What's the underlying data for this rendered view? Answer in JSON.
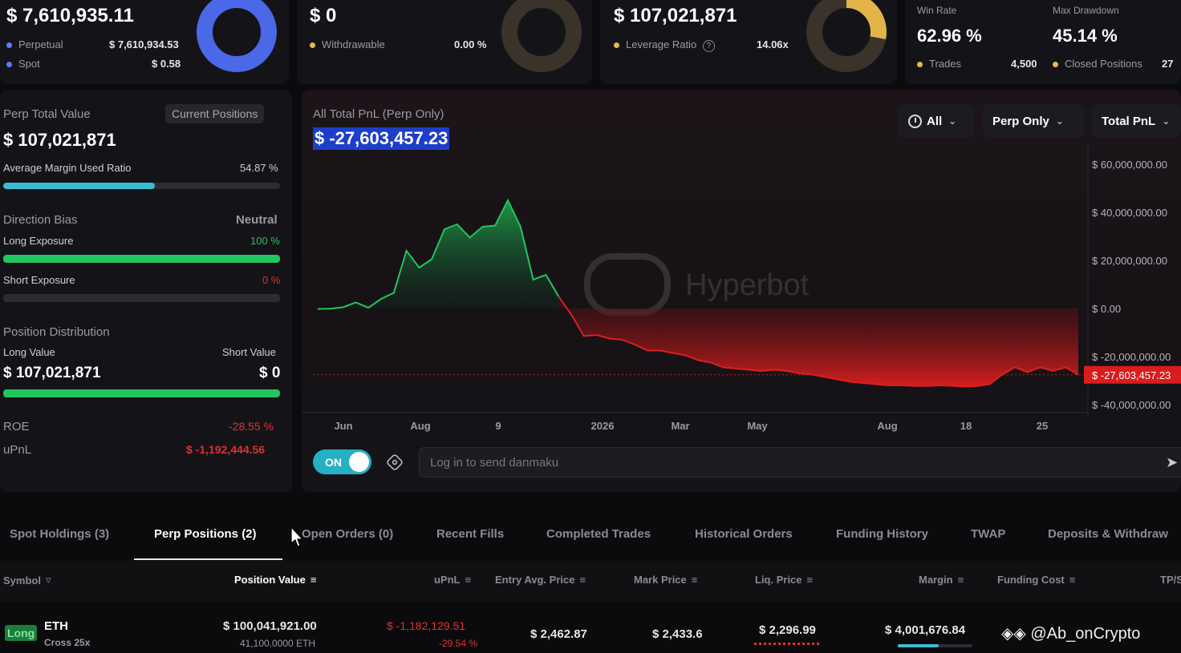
{
  "summary": {
    "total_value": "$ 7,610,935.11",
    "perpetual_label": "Perpetual",
    "perpetual_value": "$ 7,610,934.53",
    "spot_label": "Spot",
    "spot_value": "$ 0.58",
    "withdrawable_total": "$ 0",
    "withdrawable_label": "Withdrawable",
    "withdrawable_pct": "0.00 %",
    "leverage_total": "$ 107,021,871",
    "leverage_label": "Leverage Ratio",
    "leverage_value": "14.06x",
    "win_rate_label": "Win Rate",
    "win_rate_value": "62.96 %",
    "max_drawdown_label": "Max Drawdown",
    "max_drawdown_value": "45.14 %",
    "trades_label": "Trades",
    "trades_value": "4,500",
    "closed_positions_label": "Closed Positions",
    "closed_positions_value": "27"
  },
  "left_panel": {
    "perp_total_label": "Perp Total Value",
    "current_positions_button": "Current Positions",
    "perp_total_value": "$ 107,021,871",
    "avg_margin_label": "Average Margin Used Ratio",
    "avg_margin_value": "54.87 %",
    "avg_margin_fraction": 0.5487,
    "direction_bias_label": "Direction Bias",
    "direction_bias_value": "Neutral",
    "long_exposure_label": "Long Exposure",
    "long_exposure_value": "100 %",
    "long_exposure_fraction": 1.0,
    "short_exposure_label": "Short Exposure",
    "short_exposure_value": "0 %",
    "short_exposure_fraction": 0.0,
    "position_distribution_label": "Position Distribution",
    "long_value_label": "Long Value",
    "short_value_label": "Short Value",
    "long_value": "$ 107,021,871",
    "short_value": "$ 0",
    "roe_label": "ROE",
    "roe_value": "-28.55 %",
    "upnl_label": "uPnL",
    "upnl_value": "$ -1,192,444.56"
  },
  "chart_panel": {
    "title": "All Total PnL (Perp Only)",
    "value": "$ -27,603,457.23",
    "filters": {
      "range": "All",
      "scope": "Perp Only",
      "metric": "Total PnL"
    },
    "watermark": "Hyperbot",
    "danmaku_toggle": "ON",
    "danmaku_placeholder": "Log in to send danmaku"
  },
  "chart_data": {
    "type": "area",
    "title": "",
    "x_tick_labels": [
      "Jun",
      "Aug",
      "9",
      "2026",
      "Mar",
      "May",
      "Aug",
      "18",
      "25"
    ],
    "y_tick_labels": [
      "$ 60,000,000.00",
      "$ 40,000,000.00",
      "$ 20,000,000.00",
      "$ 0.00",
      "$ -20,000,000.00",
      "$ -40,000,000.00"
    ],
    "ylim": [
      -45000000,
      65000000
    ],
    "current_value_label": "$ -27,603,457.23",
    "current_value": -27603457.23,
    "positive_color": "#22c55e",
    "negative_color": "#d92020",
    "values": [
      -200000,
      -100000,
      500000,
      2500000,
      300000,
      4000000,
      6500000,
      24000000,
      17000000,
      20500000,
      33000000,
      35000000,
      29500000,
      34000000,
      34500000,
      45000000,
      34000000,
      12000000,
      14000000,
      5000000,
      -2500000,
      -11500000,
      -11000000,
      -12500000,
      -13000000,
      -15000000,
      -17500000,
      -17500000,
      -18500000,
      -19500000,
      -21500000,
      -22500000,
      -24500000,
      -25000000,
      -25500000,
      -26000000,
      -25500000,
      -26000000,
      -27000000,
      -27500000,
      -28500000,
      -29500000,
      -30500000,
      -31000000,
      -31500000,
      -32000000,
      -32000000,
      -32200000,
      -32300000,
      -32000000,
      -32200000,
      -32500000,
      -32300000,
      -31500000,
      -27500000,
      -24500000,
      -26500000,
      -24500000,
      -26000000,
      -24500000,
      -27600000
    ]
  },
  "tabs": [
    "Spot Holdings (3)",
    "Perp Positions (2)",
    "Open Orders (0)",
    "Recent Fills",
    "Completed Trades",
    "Historical Orders",
    "Funding History",
    "TWAP",
    "Deposits & Withdraw"
  ],
  "table": {
    "headers": [
      "Symbol",
      "Position Value",
      "uPnL",
      "Entry Avg. Price",
      "Mark Price",
      "Liq. Price",
      "Margin",
      "Funding Cost",
      "TP/S"
    ],
    "row": {
      "side": "Long",
      "symbol": "ETH",
      "margin_type": "Cross 25x",
      "position_value": "$ 100,041,921.00",
      "position_size": "41,100.0000 ETH",
      "upnl": "$ -1,182,129.51",
      "upnl_pct": "-29.54 %",
      "entry_price": "$ 2,462.87",
      "mark_price": "$ 2,433.6",
      "liq_price": "$ 2,296.99",
      "margin": "$ 4,001,676.84"
    }
  },
  "watermark_overlay": "@Ab_onCrypto"
}
